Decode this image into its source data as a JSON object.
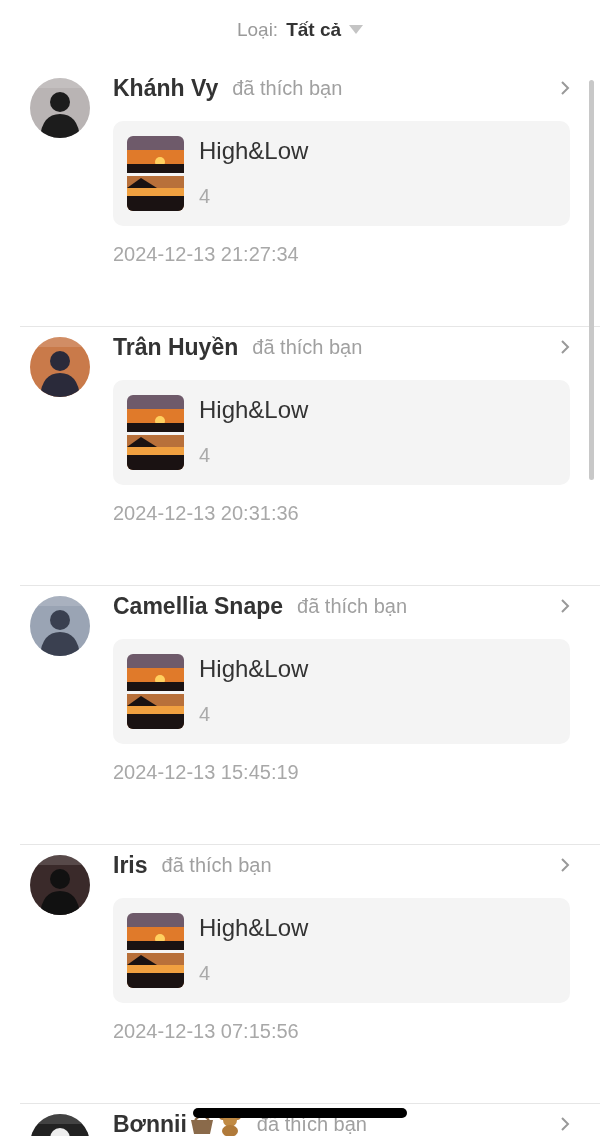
{
  "filter": {
    "label": "Loại:",
    "value": "Tất cả"
  },
  "notifications": [
    {
      "name": "Khánh Vy",
      "action": "đã thích bạn",
      "post": {
        "title": "High&Low",
        "count": "4"
      },
      "time": "2024-12-13 21:27:34"
    },
    {
      "name": "Trân Huyền",
      "action": "đã thích bạn",
      "post": {
        "title": "High&Low",
        "count": "4"
      },
      "time": "2024-12-13 20:31:36"
    },
    {
      "name": "Camellia Snape",
      "action": "đã thích bạn",
      "post": {
        "title": "High&Low",
        "count": "4"
      },
      "time": "2024-12-13 15:45:19"
    },
    {
      "name": "Iris",
      "action": "đã thích bạn",
      "post": {
        "title": "High&Low",
        "count": "4"
      },
      "time": "2024-12-13 07:15:56"
    },
    {
      "name": "Bơnnii",
      "action": "đã thích bạn"
    }
  ]
}
